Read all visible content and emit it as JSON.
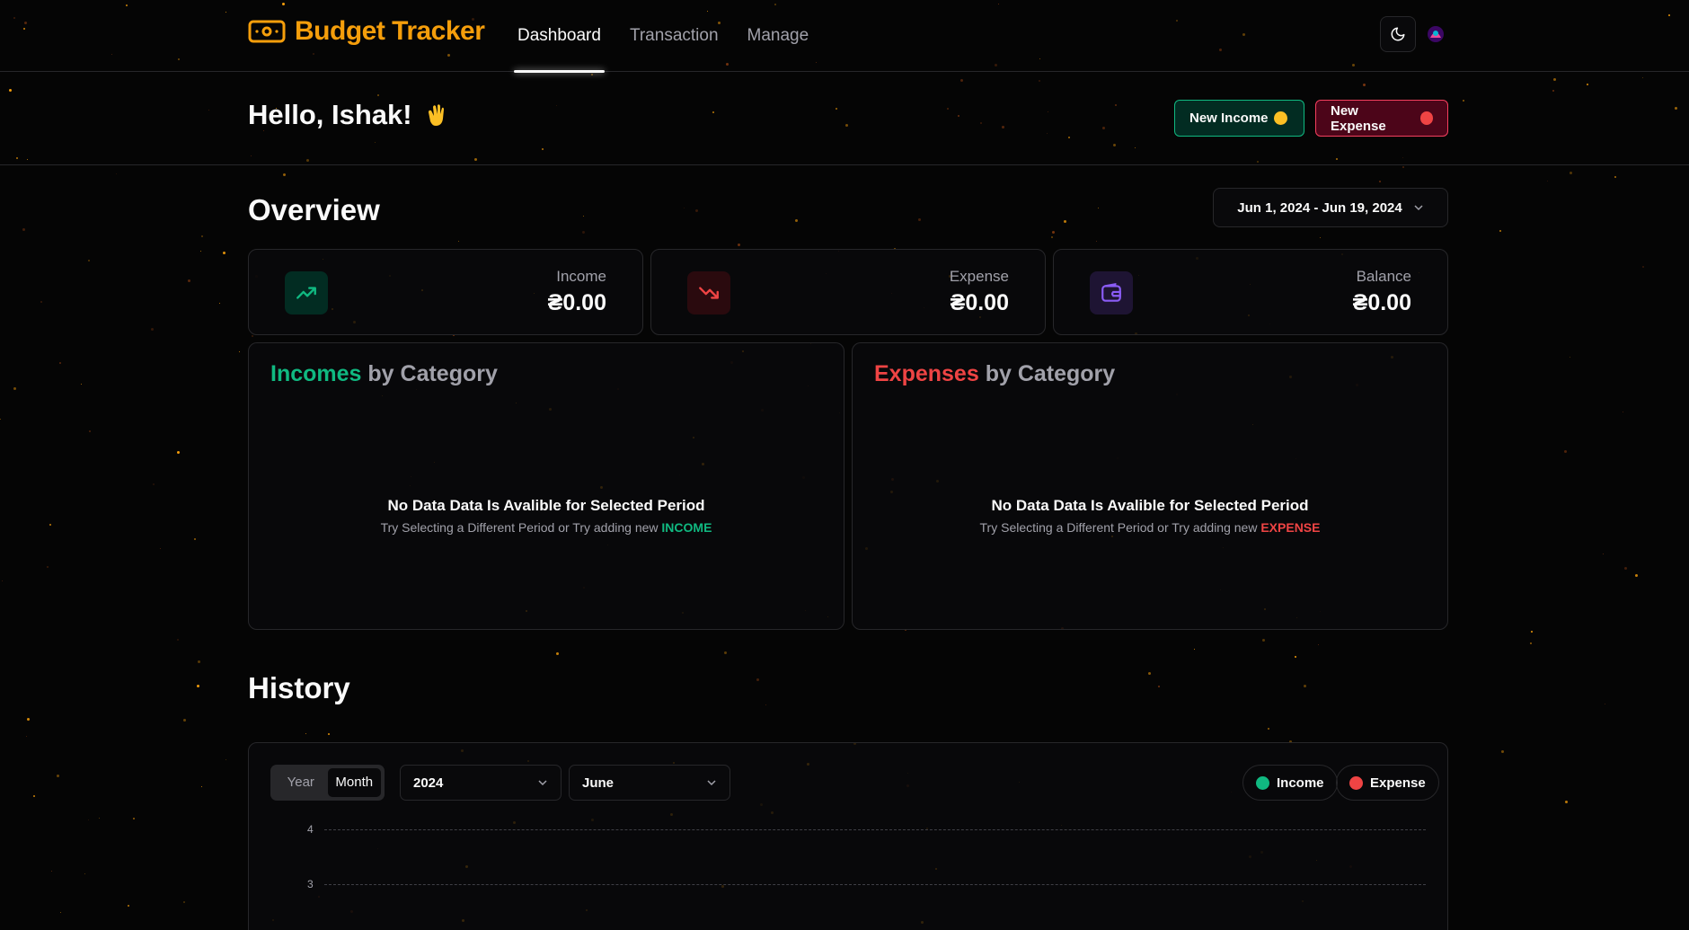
{
  "app": {
    "name": "Budget Tracker",
    "nav": [
      {
        "label": "Dashboard",
        "active": true
      },
      {
        "label": "Transaction",
        "active": false
      },
      {
        "label": "Manage",
        "active": false
      }
    ]
  },
  "greeting": {
    "text": "Hello, Ishak!",
    "new_income": "New Income",
    "new_expense": "New Expense"
  },
  "overview": {
    "title": "Overview",
    "date_range": "Jun 1, 2024 - Jun 19, 2024",
    "stats": [
      {
        "label": "Income",
        "value": "₴0.00",
        "color": "#10b981",
        "icon": "trending-up-icon"
      },
      {
        "label": "Expense",
        "value": "₴0.00",
        "color": "#ef4444",
        "icon": "trending-down-icon"
      },
      {
        "label": "Balance",
        "value": "₴0.00",
        "color": "#8b5cf6",
        "icon": "wallet-icon"
      }
    ]
  },
  "categories": {
    "income": {
      "title_accent": "Incomes",
      "title_rest": "by Category",
      "empty_title": "No Data Data Is Avalible for Selected Period",
      "empty_sub": "Try Selecting a Different Period or Try adding new",
      "empty_keyword": "INCOME"
    },
    "expense": {
      "title_accent": "Expenses",
      "title_rest": "by Category",
      "empty_title": "No Data Data Is Avalible for Selected Period",
      "empty_sub": "Try Selecting a Different Period or Try adding new",
      "empty_keyword": "EXPENSE"
    }
  },
  "history": {
    "title": "History",
    "toggle": {
      "year": "Year",
      "month": "Month",
      "selected": "Month"
    },
    "year_select": "2024",
    "month_select": "June",
    "legend": {
      "income": "Income",
      "expense": "Expense"
    },
    "y_ticks": [
      "4",
      "3"
    ]
  },
  "colors": {
    "brand": "#f59e0b",
    "income": "#10b981",
    "expense": "#ef4444",
    "balance": "#8b5cf6"
  }
}
